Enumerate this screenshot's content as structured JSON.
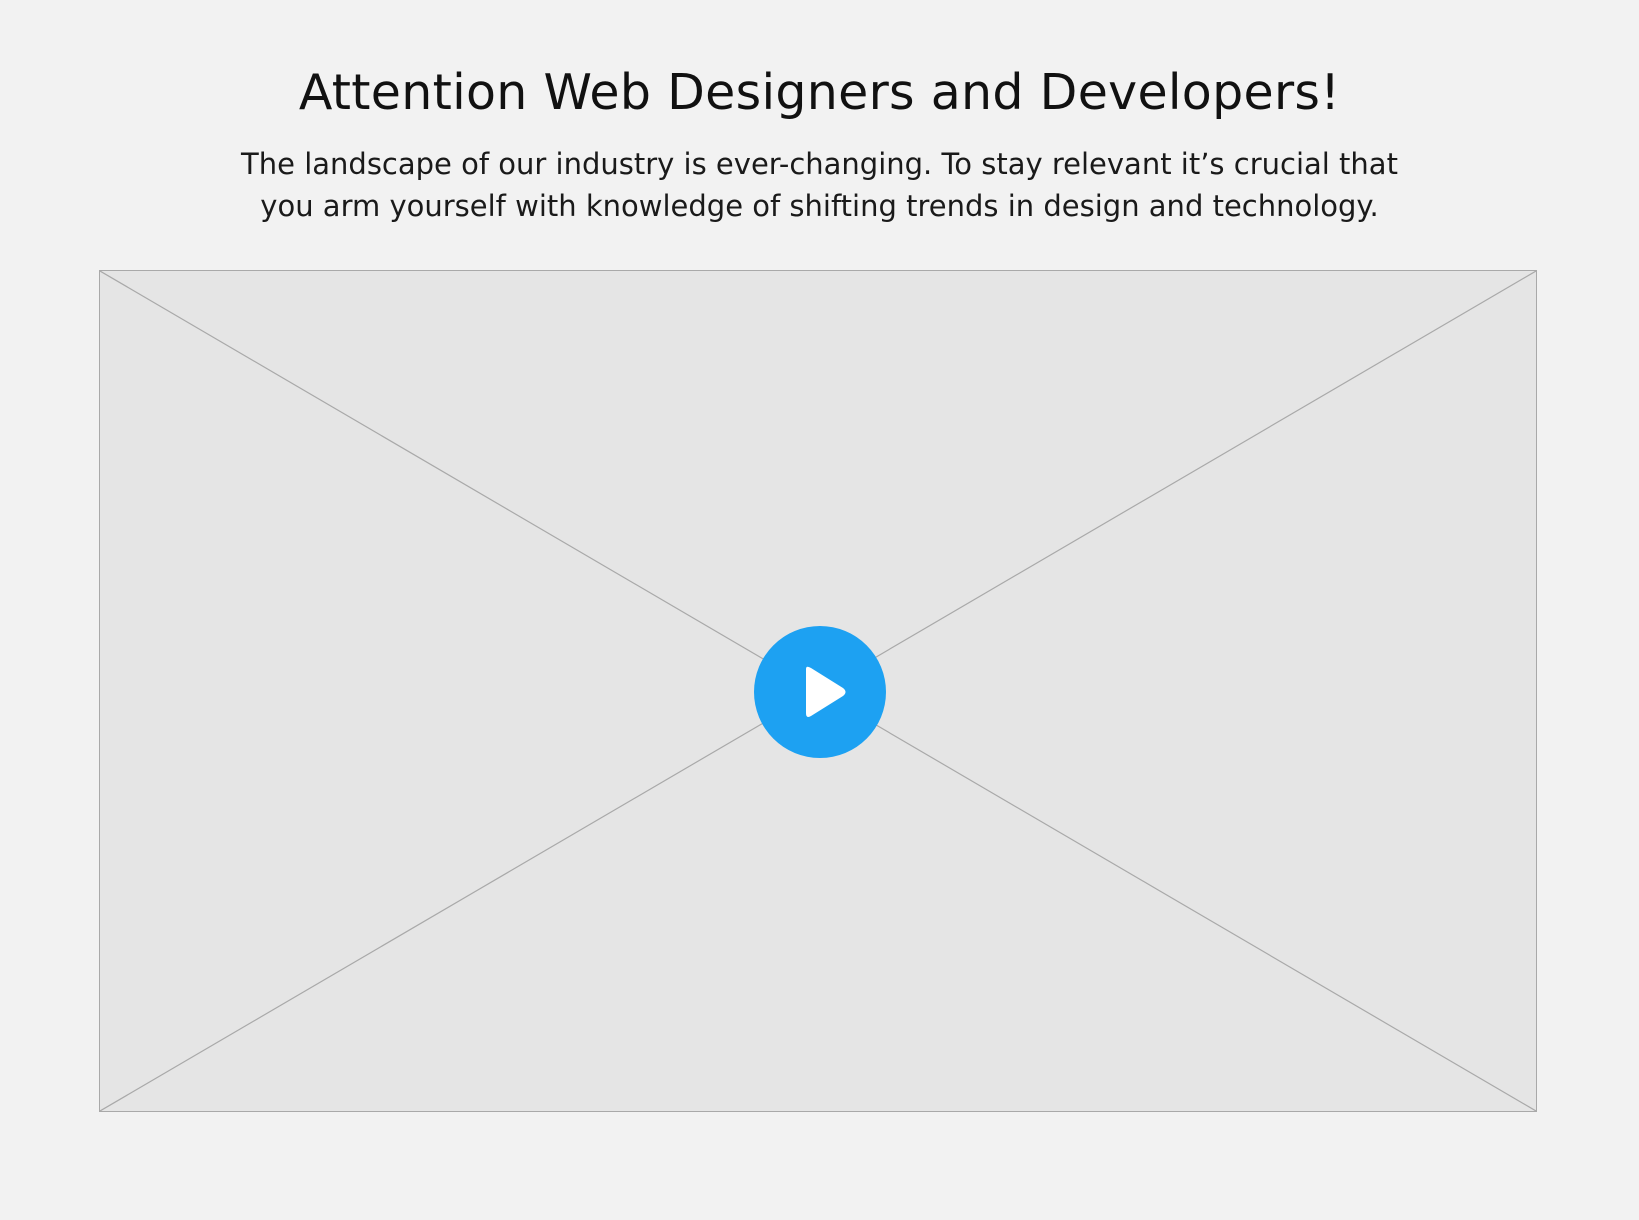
{
  "hero": {
    "title": "Attention Web Designers and Developers!",
    "intro_line_1": "The landscape of our industry is ever-changing. To stay relevant it’s crucial that",
    "intro_line_2": "you arm yourself with knowledge of shifting trends in design and technology."
  },
  "video": {
    "placeholder_icon": "image-placeholder-cross",
    "play_icon": "play-icon"
  },
  "colors": {
    "page_background": "#f2f2f2",
    "video_background": "#e5e5e5",
    "placeholder_lines": "#a9a9a9",
    "accent": "#1da1f2",
    "play_glyph": "#ffffff"
  }
}
